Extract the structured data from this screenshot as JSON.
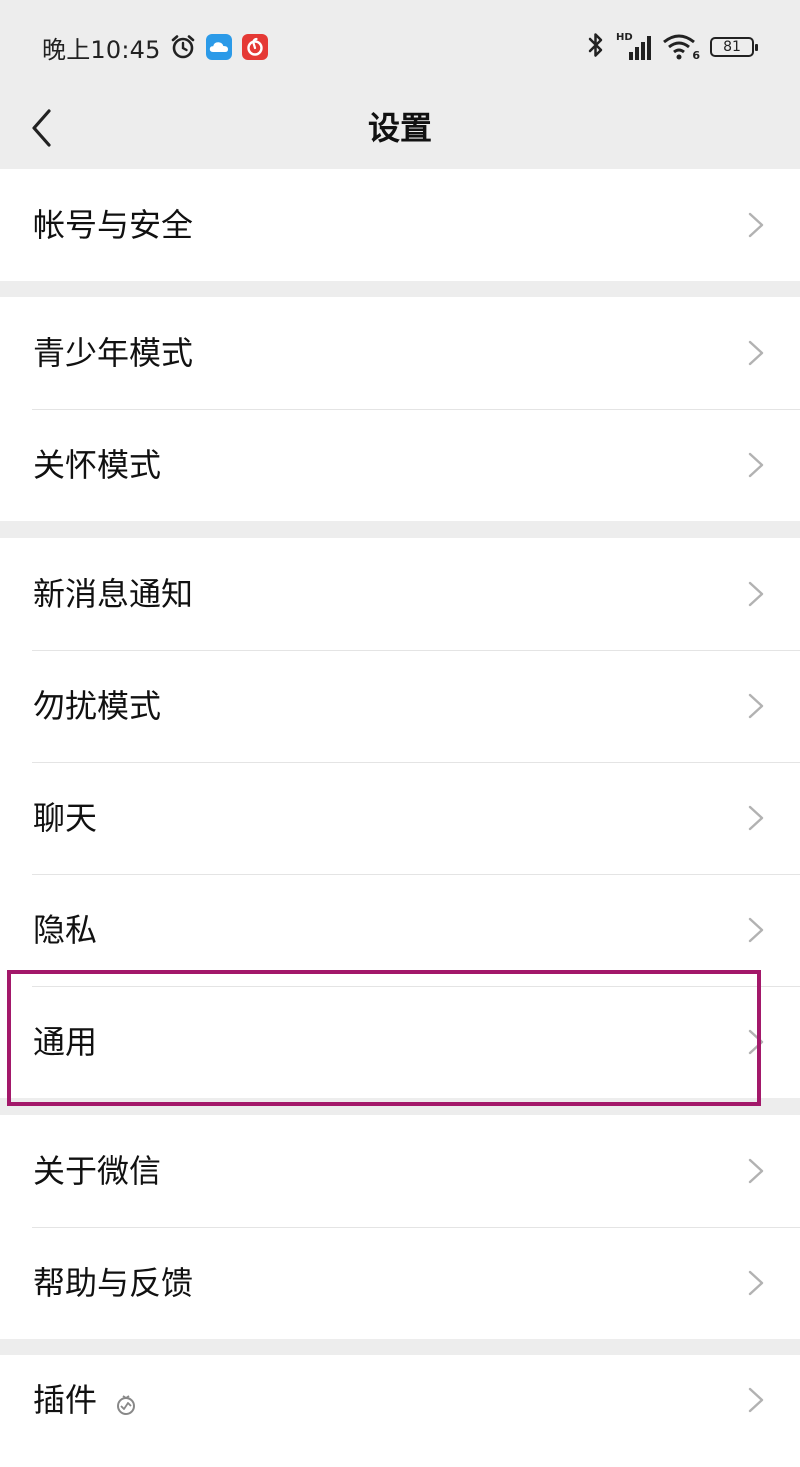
{
  "status_bar": {
    "time": "晚上10:45",
    "network_type": "HD",
    "wifi_generation": "6",
    "battery_level": "81",
    "icons": [
      "alarm-icon",
      "cloud-icon",
      "music-app-icon",
      "bluetooth-icon",
      "signal-icon",
      "wifi-icon",
      "battery-icon"
    ]
  },
  "header": {
    "title": "设置",
    "back_icon": "chevron-left-icon"
  },
  "groups": [
    {
      "items": [
        {
          "label": "帐号与安全"
        }
      ]
    },
    {
      "items": [
        {
          "label": "青少年模式"
        },
        {
          "label": "关怀模式"
        }
      ]
    },
    {
      "items": [
        {
          "label": "新消息通知"
        },
        {
          "label": "勿扰模式"
        },
        {
          "label": "聊天"
        },
        {
          "label": "隐私"
        },
        {
          "label": "通用",
          "highlighted": true
        }
      ]
    },
    {
      "items": [
        {
          "label": "关于微信"
        },
        {
          "label": "帮助与反馈"
        }
      ]
    },
    {
      "items": [
        {
          "label": "插件",
          "icon": "plugin-icon"
        }
      ]
    }
  ],
  "colors": {
    "background": "#ededed",
    "row_background": "#ffffff",
    "divider": "#e4e4e4",
    "highlight": "#a3186a",
    "chevron": "#b2b2b2",
    "cloud_icon": "#2b9ae8",
    "music_icon": "#e53935"
  }
}
